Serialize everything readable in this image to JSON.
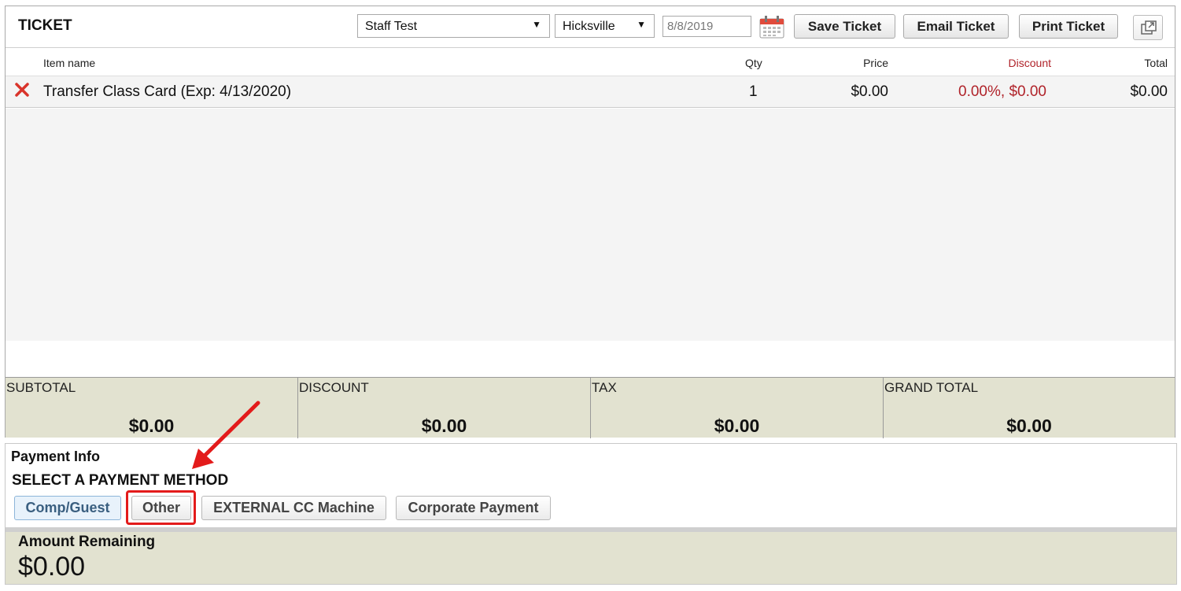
{
  "ticket": {
    "title": "TICKET",
    "staff_select": "Staff Test",
    "location_select": "Hicksville",
    "date_value": "8/8/2019",
    "save_label": "Save Ticket",
    "email_label": "Email Ticket",
    "print_label": "Print Ticket"
  },
  "columns": {
    "item_name": "Item name",
    "qty": "Qty",
    "price": "Price",
    "discount": "Discount",
    "total": "Total"
  },
  "items": [
    {
      "name": "Transfer Class Card (Exp: 4/13/2020)",
      "qty": "1",
      "price": "$0.00",
      "discount": "0.00%, $0.00",
      "total": "$0.00"
    }
  ],
  "totals": {
    "subtotal_label": "SUBTOTAL",
    "subtotal_value": "$0.00",
    "discount_label": "DISCOUNT",
    "discount_value": "$0.00",
    "tax_label": "TAX",
    "tax_value": "$0.00",
    "grand_total_label": "GRAND TOTAL",
    "grand_total_value": "$0.00"
  },
  "payment": {
    "info_label": "Payment Info",
    "select_label": "SELECT A PAYMENT METHOD",
    "methods": [
      "Comp/Guest",
      "Other",
      "EXTERNAL CC Machine",
      "Corporate Payment"
    ],
    "amount_remaining_label": "Amount Remaining",
    "amount_remaining_value": "$0.00"
  },
  "colors": {
    "discount_red": "#b0232a",
    "remove_red": "#d9342b",
    "totals_bg": "#e2e2d0",
    "highlight_red": "#e31b1b"
  },
  "icons": [
    "calendar-icon",
    "popout-icon",
    "remove-icon",
    "annotation-arrow-icon"
  ]
}
